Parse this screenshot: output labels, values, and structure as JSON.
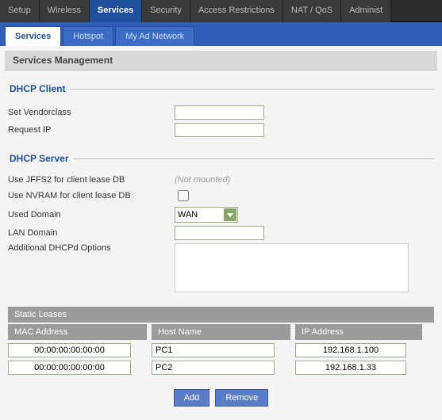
{
  "topTabs": {
    "items": [
      {
        "label": "Setup"
      },
      {
        "label": "Wireless"
      },
      {
        "label": "Services"
      },
      {
        "label": "Security"
      },
      {
        "label": "Access Restrictions"
      },
      {
        "label": "NAT / QoS"
      },
      {
        "label": "Administ"
      }
    ],
    "activeIndex": 2
  },
  "subTabs": {
    "items": [
      {
        "label": "Services"
      },
      {
        "label": "Hotspot"
      },
      {
        "label": "My Ad Network"
      }
    ],
    "activeIndex": 0
  },
  "page": {
    "title": "Services Management"
  },
  "dhcpClient": {
    "legend": "DHCP Client",
    "vendorclass_label": "Set Vendorclass",
    "vendorclass_value": "",
    "requestip_label": "Request IP",
    "requestip_value": ""
  },
  "dhcpServer": {
    "legend": "DHCP Server",
    "jffs2_label": "Use JFFS2 for client lease DB",
    "jffs2_status": "(Not mounted)",
    "nvram_label": "Use NVRAM for client lease DB",
    "nvram_checked": false,
    "useddomain_label": "Used Domain",
    "useddomain_value": "WAN",
    "useddomain_options": [
      "WAN"
    ],
    "landomain_label": "LAN Domain",
    "landomain_value": "",
    "addopts_label": "Additional DHCPd Options",
    "addopts_value": ""
  },
  "staticLeases": {
    "title": "Static Leases",
    "headers": {
      "mac": "MAC Address",
      "host": "Host Name",
      "ip": "IP Address"
    },
    "rows": [
      {
        "mac": "00:00:00:00:00:00",
        "host": "PC1",
        "ip": "192.168.1.100"
      },
      {
        "mac": "00:00:00:00:00:00",
        "host": "PC2",
        "ip": "192.168.1.33"
      }
    ]
  },
  "buttons": {
    "add": "Add",
    "remove": "Remove"
  }
}
